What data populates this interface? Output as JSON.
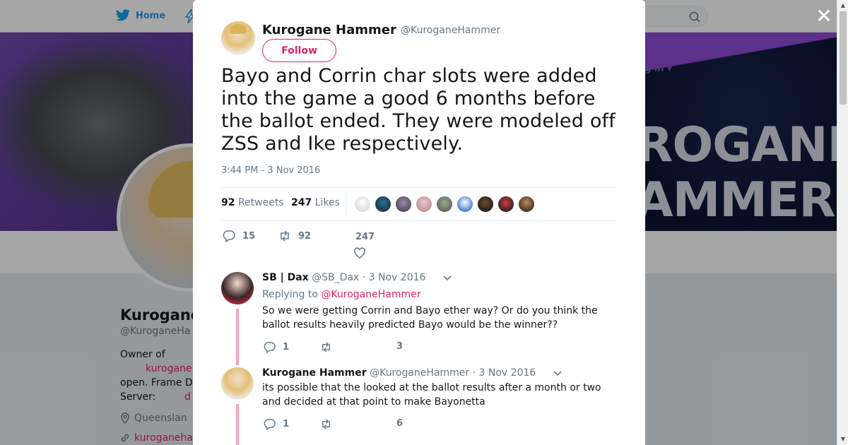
{
  "topnav": {
    "home_label": "Home"
  },
  "banner": {
    "line1": "ROGANE",
    "line2": "AMMER",
    "login_hint": "g in ▾"
  },
  "profile": {
    "name": "Kurogane",
    "handle": "@KuroganeHa",
    "bio_line1": "Owner of",
    "bio_link": "kurogane",
    "bio_line3": "open. Frame D",
    "bio_line4": "Server:",
    "bio_link2": "d",
    "location": "Queenslan",
    "url": "kuroganeha"
  },
  "modal": {
    "author_name": "Kurogane Hammer",
    "author_handle": "@KuroganeHammer",
    "follow_label": "Follow",
    "tweet_text": "Bayo and Corrin char slots were added into the game a good 6 months before the ballot ended. They were modeled off ZSS and Ike respectively.",
    "timestamp": "3:44 PM - 3 Nov 2016",
    "retweets_count": "92",
    "retweets_label": "Retweets",
    "likes_count": "247",
    "likes_label": "Likes",
    "reply_count": "15",
    "retweet_action_count": "92",
    "like_action_count": "247"
  },
  "replies": [
    {
      "name": "SB | Dax",
      "handle": "@SB_Dax",
      "date": "· 3 Nov 2016",
      "replying_prefix": "Replying to",
      "replying_to": "@KuroganeHammer",
      "text": "So we were getting Corrin and Bayo ether way? Or do you think the ballot results heavily predicted Bayo would be the winner??",
      "reply_count": "1",
      "like_count": "3"
    },
    {
      "name": "Kurogane Hammer",
      "handle": "@KuroganeHammer",
      "date": "· 3 Nov 2016",
      "text": "its possible that the looked at the ballot results after a month or two and decided at that point to make Bayonetta",
      "reply_count": "1",
      "like_count": "6"
    }
  ],
  "colors": {
    "accent": "#e0245e",
    "twitter_blue": "#1da1f2",
    "secondary_text": "#657786",
    "thread_line": "#f4a6bc"
  },
  "icons": [
    "twitter-bird-icon",
    "search-icon",
    "close-icon",
    "reply-icon",
    "retweet-icon",
    "heart-icon",
    "chevron-down-icon",
    "location-icon",
    "link-icon"
  ]
}
